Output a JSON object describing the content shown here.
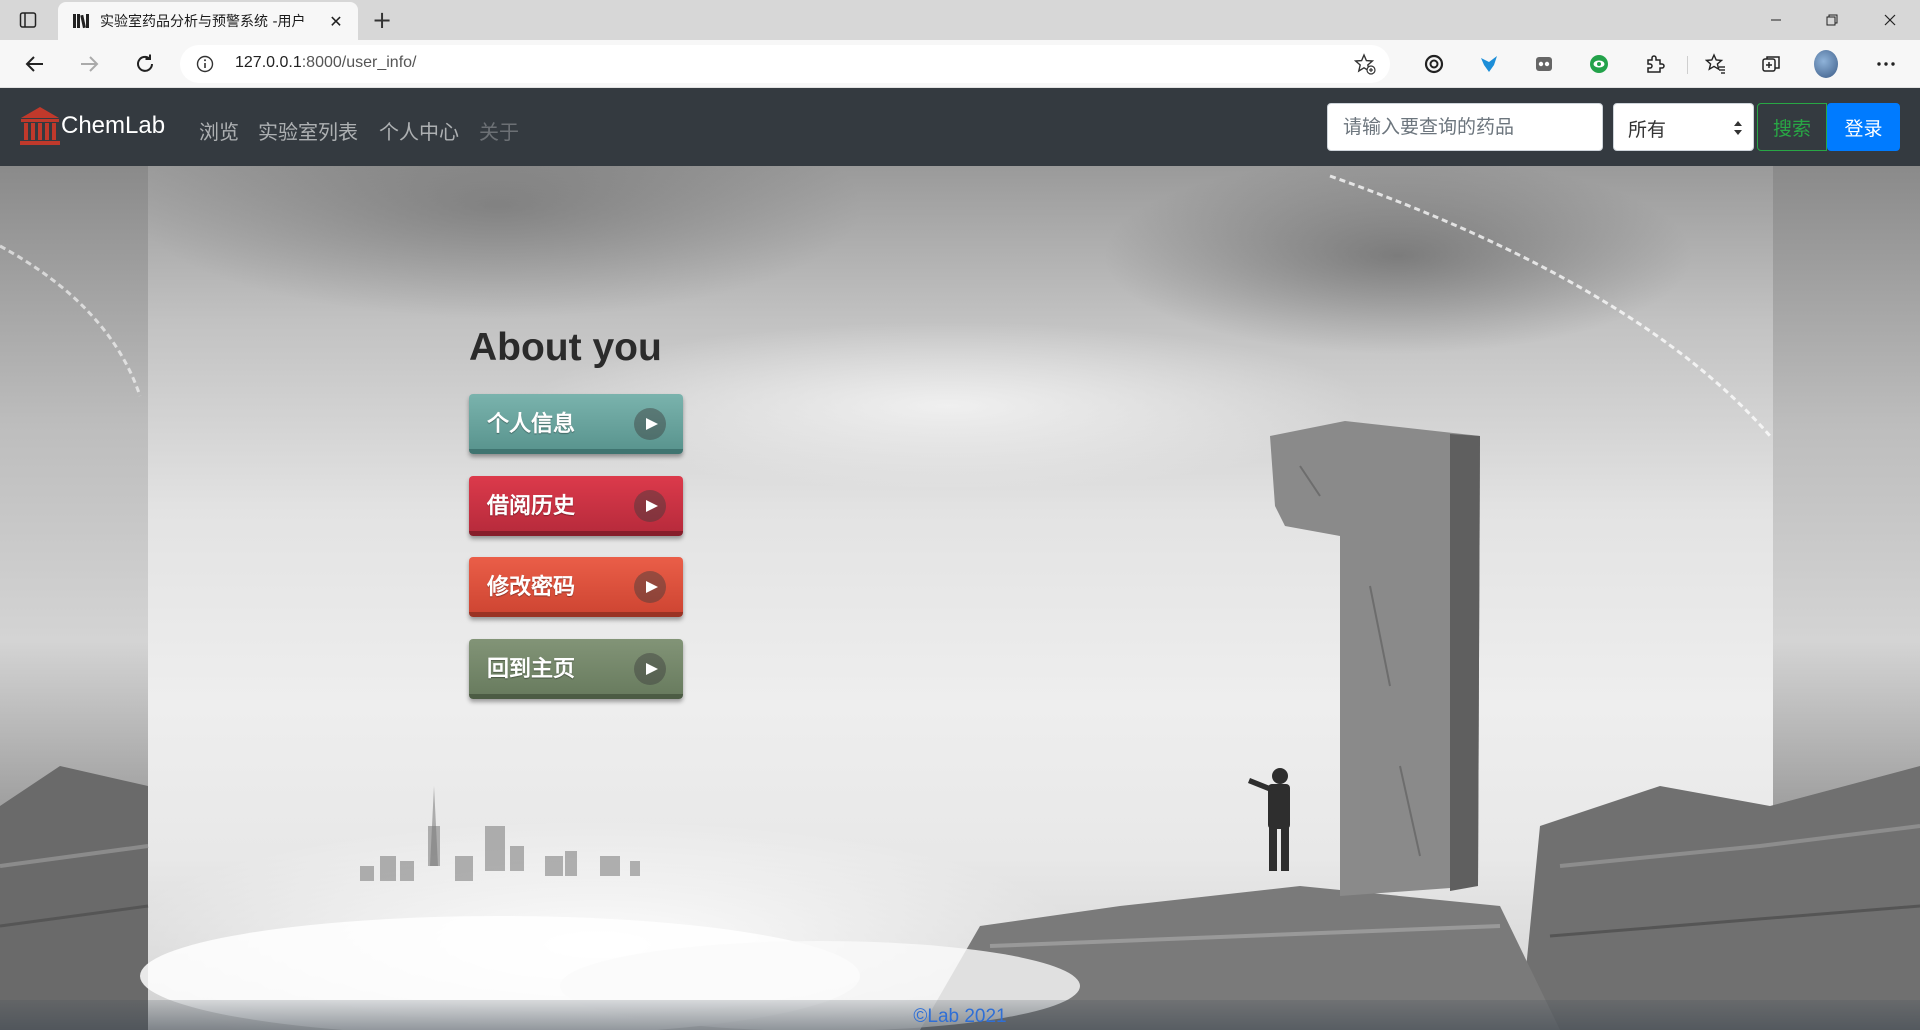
{
  "browser": {
    "tab_title": "实验室药品分析与预警系统 -用户",
    "new_tab_icon": "plus-icon",
    "url_host": "127.0.0.1",
    "url_path": ":8000/user_info/"
  },
  "navbar": {
    "brand": "ChemLab",
    "links": [
      "浏览",
      "实验室列表",
      "个人中心",
      "关于"
    ],
    "search_placeholder": "请输入要查询的药品",
    "select_value": "所有",
    "search_button": "搜索",
    "login_button": "登录",
    "colors": {
      "navbar_bg": "#343a40",
      "search_green": "#28a745",
      "login_blue": "#007bff",
      "brand_logo_red": "#c0392b"
    }
  },
  "main": {
    "title": "About you",
    "menu": [
      {
        "label": "个人信息",
        "color": "#6aa6a0"
      },
      {
        "label": "借阅历史",
        "color": "#c93444"
      },
      {
        "label": "修改密码",
        "color": "#de523e"
      },
      {
        "label": "回到主页",
        "color": "#77896c"
      }
    ]
  },
  "footer": {
    "text": "©Lab 2021"
  }
}
